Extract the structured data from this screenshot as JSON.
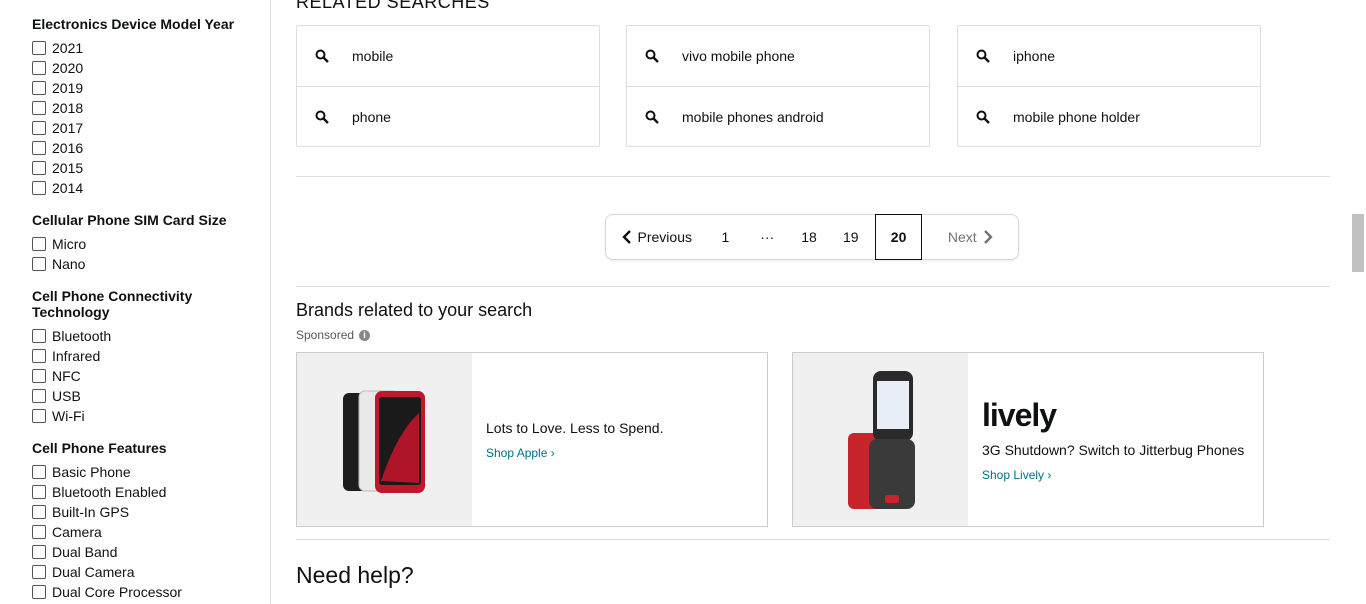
{
  "sidebar": {
    "sections": [
      {
        "title": "Electronics Device Model Year",
        "options": [
          "2021",
          "2020",
          "2019",
          "2018",
          "2017",
          "2016",
          "2015",
          "2014"
        ]
      },
      {
        "title": "Cellular Phone SIM Card Size",
        "options": [
          "Micro",
          "Nano"
        ]
      },
      {
        "title": "Cell Phone Connectivity Technology",
        "options": [
          "Bluetooth",
          "Infrared",
          "NFC",
          "USB",
          "Wi-Fi"
        ]
      },
      {
        "title": "Cell Phone Features",
        "options": [
          "Basic Phone",
          "Bluetooth Enabled",
          "Built-In GPS",
          "Camera",
          "Dual Band",
          "Dual Camera",
          "Dual Core Processor"
        ]
      }
    ]
  },
  "related": {
    "title": "RELATED SEARCHES",
    "columns": [
      [
        "mobile",
        "phone"
      ],
      [
        "vivo mobile phone",
        "mobile phones android"
      ],
      [
        "iphone",
        "mobile phone holder"
      ]
    ]
  },
  "pagination": {
    "prev": "Previous",
    "pages": [
      "1",
      "···",
      "18",
      "19",
      "20"
    ],
    "current": "20",
    "next": "Next"
  },
  "brands": {
    "title": "Brands related to your search",
    "sponsored": "Sponsored",
    "cards": [
      {
        "text": "Lots to Love. Less to Spend.",
        "link": "Shop Apple",
        "logo": ""
      },
      {
        "text": "3G Shutdown? Switch to Jitterbug Phones",
        "link": "Shop Lively",
        "logo": "lively"
      }
    ]
  },
  "help": {
    "title": "Need help?"
  },
  "colors": {
    "link": "#007185",
    "border": "#dddddd"
  }
}
